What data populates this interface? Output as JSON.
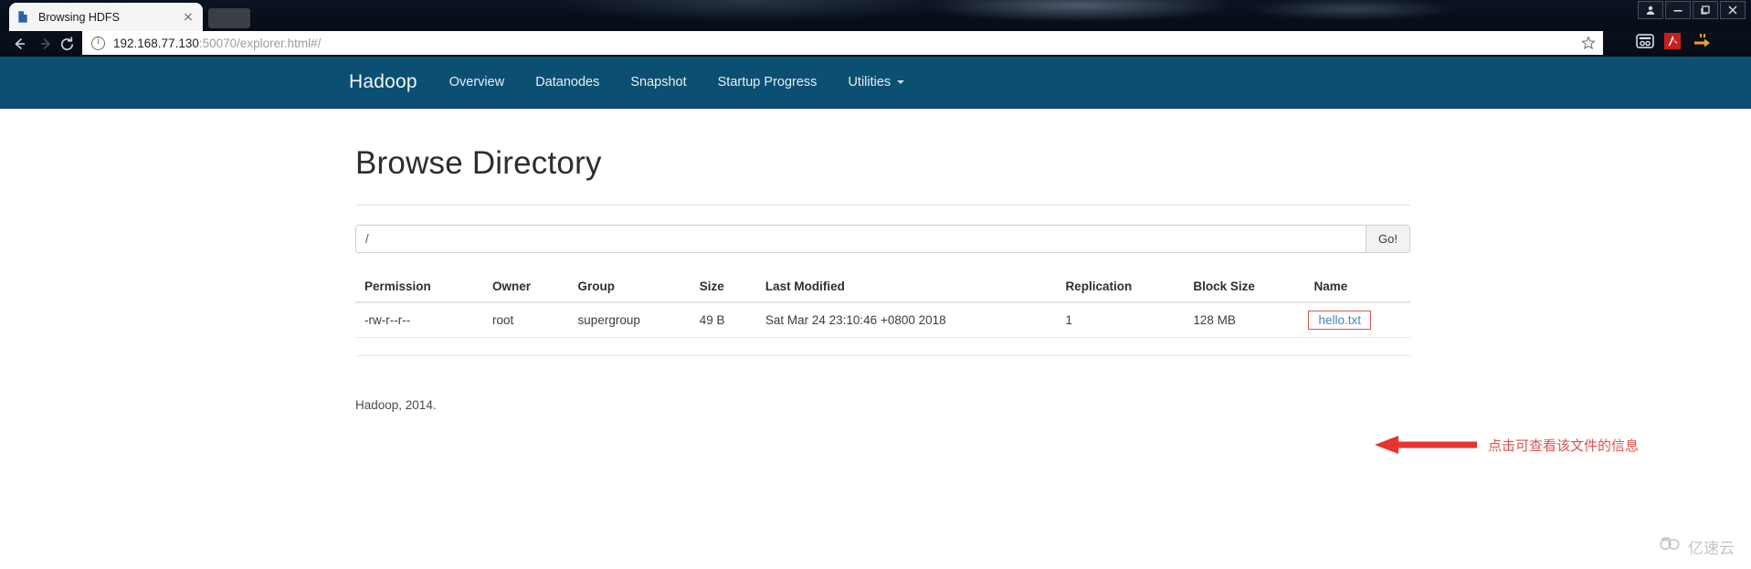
{
  "browser": {
    "tab": {
      "title": "Browsing HDFS",
      "favicon": "document-icon",
      "close": "close-icon"
    },
    "new_tab_label": "",
    "nav": {
      "back": "back-arrow-icon",
      "forward": "forward-arrow-icon",
      "reload": "reload-icon"
    },
    "omnibox": {
      "info_icon": "info-circle-icon",
      "url_host": "192.168.77.130",
      "url_rest": ":50070/explorer.html#/",
      "url_full": "192.168.77.130:50070/explorer.html#/",
      "star_icon": "star-icon"
    },
    "extensions": [
      {
        "name": "extension-icon"
      },
      {
        "name": "adobe-pdf-icon"
      },
      {
        "name": "download-arrow-icon"
      }
    ],
    "window_buttons": [
      {
        "name": "profile-button",
        "glyph": "person"
      },
      {
        "name": "minimize-button",
        "glyph": "minimize"
      },
      {
        "name": "maximize-button",
        "glyph": "maximize"
      },
      {
        "name": "close-window-button",
        "glyph": "close"
      }
    ]
  },
  "navbar": {
    "brand": "Hadoop",
    "accent_color": "#0b4f73",
    "links": [
      {
        "label": "Overview"
      },
      {
        "label": "Datanodes"
      },
      {
        "label": "Snapshot"
      },
      {
        "label": "Startup Progress"
      }
    ],
    "dropdown": {
      "label": "Utilities",
      "caret": "caret-down-icon"
    }
  },
  "main": {
    "title": "Browse Directory",
    "path_input": {
      "value": "/",
      "placeholder": ""
    },
    "go_button": "Go!",
    "table": {
      "headers": [
        "Permission",
        "Owner",
        "Group",
        "Size",
        "Last Modified",
        "Replication",
        "Block Size",
        "Name"
      ],
      "rows": [
        {
          "permission": "-rw-r--r--",
          "owner": "root",
          "group": "supergroup",
          "size": "49 B",
          "last_modified": "Sat Mar 24 23:10:46 +0800 2018",
          "replication": "1",
          "block_size": "128 MB",
          "name": "hello.txt",
          "name_highlighted": true
        }
      ]
    },
    "footer": "Hadoop, 2014."
  },
  "annotation": {
    "text": "点击可查看该文件的信息",
    "color": "#e0504d",
    "arrow": "left-arrow-icon"
  },
  "watermark": {
    "text": "亿速云",
    "icon": "cloud-icon"
  }
}
